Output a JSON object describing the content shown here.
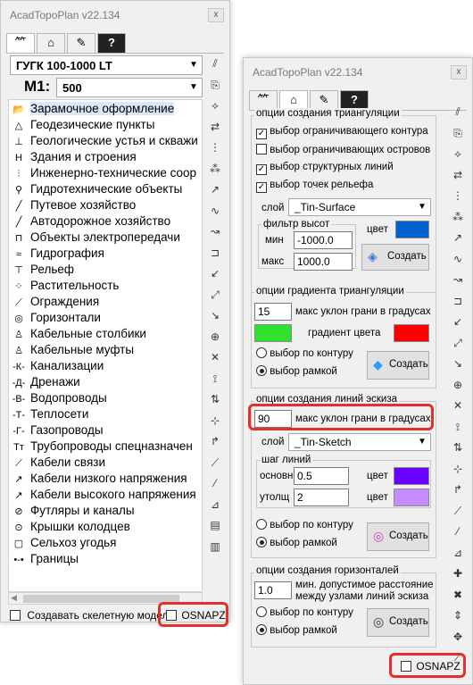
{
  "colors": {
    "accent_red": "#e0312b",
    "blue": "#0060d0",
    "green": "#2fe22f",
    "red": "#ff0000",
    "purple": "#6a00ff",
    "lilac": "#c48cff"
  },
  "left": {
    "title": "AcadTopoPlan v22.134",
    "close": "x",
    "tabs": [
      "tree-icon",
      "house-icon",
      "edit-icon",
      "help-icon"
    ],
    "tab_glyphs": [
      "⺮",
      "⌂",
      "✎",
      "?"
    ],
    "scale_select": "ГУГК 100-1000 LT",
    "m_label": "М1:",
    "m_value": "500",
    "items": [
      {
        "label": "Зарамочное оформление",
        "icon": "📂"
      },
      {
        "label": "Геодезические пункты",
        "icon": "△"
      },
      {
        "label": "Геологические устья и скважи",
        "icon": "⊥"
      },
      {
        "label": "Здания и строения",
        "icon": "Н"
      },
      {
        "label": "Инженерно-технические соор",
        "icon": "⫶"
      },
      {
        "label": "Гидротехнические объекты",
        "icon": "⚲"
      },
      {
        "label": "Путевое хозяйство",
        "icon": "╱"
      },
      {
        "label": "Автодорожное хозяйство",
        "icon": "╱"
      },
      {
        "label": "Объекты электропередачи",
        "icon": "⊓"
      },
      {
        "label": "Гидрография",
        "icon": "≈"
      },
      {
        "label": "Рельеф",
        "icon": "⊤"
      },
      {
        "label": "Растительность",
        "icon": "⁘"
      },
      {
        "label": "Ограждения",
        "icon": "⟋"
      },
      {
        "label": "Горизонтали",
        "icon": "◎"
      },
      {
        "label": "Кабельные столбики",
        "icon": "♙"
      },
      {
        "label": "Кабельные муфты",
        "icon": "♙"
      },
      {
        "label": "Канализации",
        "icon": "-К-"
      },
      {
        "label": "Дренажи",
        "icon": "-Д-"
      },
      {
        "label": "Водопроводы",
        "icon": "-В-"
      },
      {
        "label": "Теплосети",
        "icon": "-Т-"
      },
      {
        "label": "Газопроводы",
        "icon": "-Г-"
      },
      {
        "label": "Трубопроводы спецназначен",
        "icon": "Тт"
      },
      {
        "label": "Кабели связи",
        "icon": "⟋"
      },
      {
        "label": "Кабели низкого напряжения",
        "icon": "↗"
      },
      {
        "label": "Кабели высокого напряжения",
        "icon": "↗"
      },
      {
        "label": "Футляры и каналы",
        "icon": "⊘"
      },
      {
        "label": "Крышки колодцев",
        "icon": "⊙"
      },
      {
        "label": "Сельхоз угодья",
        "icon": "▢"
      },
      {
        "label": "Границы",
        "icon": "•-•"
      }
    ],
    "skeleton_label": "Создавать скелетную модель",
    "osnapz_label": "OSNAPZ"
  },
  "right": {
    "title": "AcadTopoPlan v22.134",
    "close": "x",
    "triangulation": {
      "title": "опции создания триангуляции",
      "cb1": "выбор ограничивающего контура",
      "cb2": "выбор ограничивающих островов",
      "cb3": "выбор структурных линий",
      "cb4": "выбор точек рельефа",
      "layer_label": "слой",
      "layer_value": "_Tin-Surface",
      "filter_title": "фильтр высот",
      "min_label": "мин",
      "min_value": "-1000.0",
      "max_label": "макс",
      "max_value": "1000.0",
      "color_label": "цвет",
      "create": "Создать"
    },
    "gradient": {
      "title": "опции градиента триангуляции",
      "slope_value": "15",
      "slope_label": "макс уклон грани в градусах",
      "gradient_label": "градиент цвета",
      "r1": "выбор по контуру",
      "r2": "выбор рамкой",
      "create": "Создать"
    },
    "sketch": {
      "title": "опции создания линий эскиза",
      "slope_value": "90",
      "slope_label": "макс уклон грани в градусах",
      "layer_label": "слой",
      "layer_value": "_Tin-Sketch",
      "step_title": "шаг линий",
      "main_label": "основн",
      "main_value": "0.5",
      "thick_label": "утолщ",
      "thick_value": "2",
      "color_label": "цвет",
      "r1": "выбор по контуру",
      "r2": "выбор рамкой",
      "create": "Создать"
    },
    "contours": {
      "title": "опции создания горизонталей",
      "dist_value": "1.0",
      "dist_label1": "мин. допустимое расстояние",
      "dist_label2": "между узлами линий эскиза",
      "r1": "выбор по контуру",
      "r2": "выбор рамкой",
      "create": "Создать"
    },
    "osnapz_label": "OSNAPZ"
  }
}
